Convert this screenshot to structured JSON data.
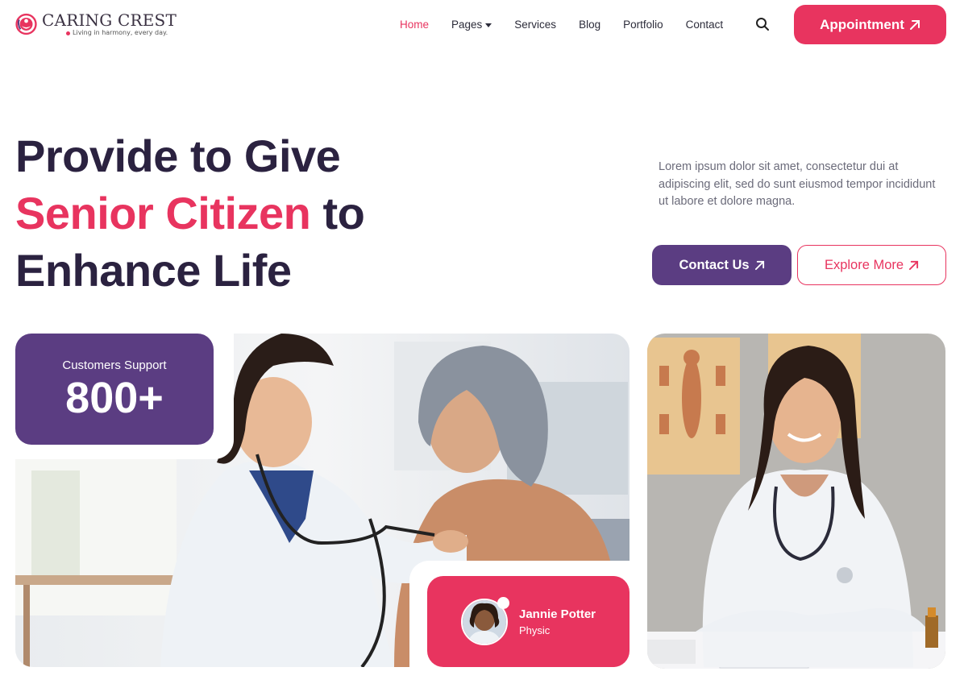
{
  "header": {
    "brand": "CARING CREST",
    "tagline": "Living in harmony, every day.",
    "nav": [
      {
        "label": "Home",
        "active": true
      },
      {
        "label": "Pages",
        "has_dropdown": true
      },
      {
        "label": "Services"
      },
      {
        "label": "Blog"
      },
      {
        "label": "Portfolio"
      },
      {
        "label": "Contact"
      }
    ],
    "search_icon": "search-icon",
    "appointment_label": "Appointment",
    "appointment_icon": "arrow-up-right-icon"
  },
  "hero": {
    "title_line1": "Provide to Give",
    "title_line2_accent": "Senior Citizen",
    "title_line2_rest": " to",
    "title_line3": "Enhance Life",
    "description": "Lorem ipsum dolor sit amet, consectetur dui at adipiscing elit, sed do sunt eiusmod tempor incididunt ut labore et dolore magna.",
    "contact_label": "Contact Us",
    "explore_label": "Explore More"
  },
  "stat": {
    "label": "Customers Support",
    "value": "800+"
  },
  "profile": {
    "name": "Jannie Potter",
    "role": "Physic"
  },
  "colors": {
    "accent": "#e8345f",
    "purple": "#5b3d82",
    "heading": "#2b2240"
  }
}
